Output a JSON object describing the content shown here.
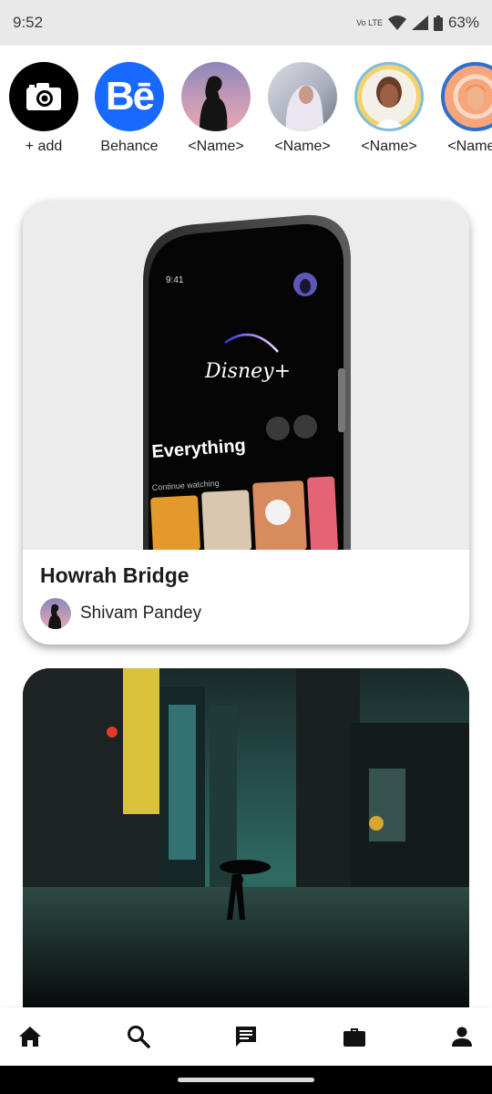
{
  "status_bar": {
    "time": "9:52",
    "network_label": "Vo LTE",
    "battery_percent": "63%"
  },
  "stories": [
    {
      "label": "+ add",
      "icon": "camera-icon"
    },
    {
      "label": "Behance",
      "icon": "behance-logo"
    },
    {
      "label": "<Name>"
    },
    {
      "label": "<Name>"
    },
    {
      "label": "<Name>"
    },
    {
      "label": "<Name>"
    }
  ],
  "posts": [
    {
      "title": "Howrah Bridge",
      "author": "Shivam Pandey",
      "image": {
        "phone_time": "9:41",
        "app_logo": "Disney+",
        "heading": "Everything",
        "section": "Continue watching"
      }
    }
  ],
  "bottom_nav": [
    "home-icon",
    "search-icon",
    "chat-icon",
    "briefcase-icon",
    "person-icon"
  ],
  "colors": {
    "status_bar_bg": "#e9e9e9",
    "behance_blue": "#1769ff",
    "card_bg": "#ffffff",
    "text": "#1c1c1c"
  }
}
